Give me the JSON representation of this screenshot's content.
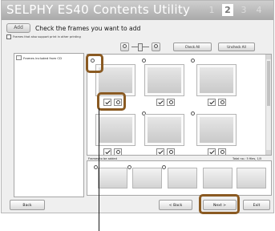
{
  "window": {
    "title": "SELPHY ES40 Contents Utility"
  },
  "steps": [
    "1",
    "2",
    "3",
    "4"
  ],
  "active_step_index": 1,
  "instruction": {
    "badge": "Add",
    "text": "Check the frames you want to add"
  },
  "note": "Frames that also support print in other printing",
  "toolbar": {
    "check_all": "Check All",
    "uncheck_all": "Uncheck All"
  },
  "left_pane": {
    "folder_label": "Frames included from CD"
  },
  "sections": {
    "added_label": "Frames to be added",
    "count_label": "Total no.: 5 files, 1/5"
  },
  "buttons": {
    "back_main": "Back",
    "back": "< Back",
    "next": "Next >",
    "exit": "Exit"
  }
}
